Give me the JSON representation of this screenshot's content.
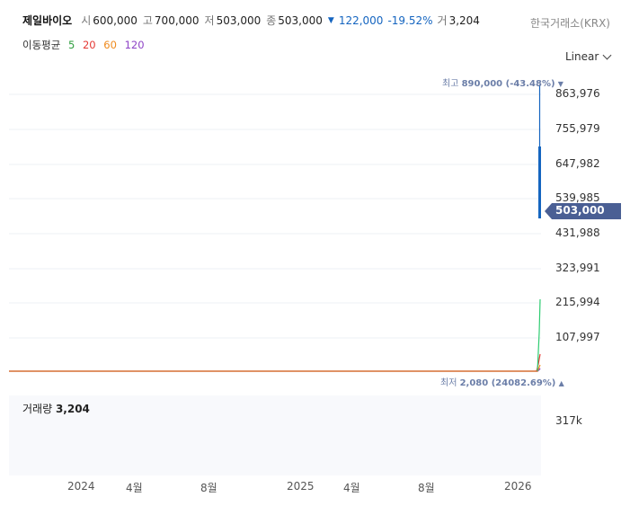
{
  "header": {
    "stock_name": "제일바이오",
    "open_label": "시",
    "open_value": "600,000",
    "high_label": "고",
    "high_value": "700,000",
    "low_label": "저",
    "low_value": "503,000",
    "close_label": "종",
    "close_value": "503,000",
    "change_arrow": "▼",
    "change_value": "122,000",
    "change_pct": "-19.52%",
    "volume_label": "거",
    "volume_value": "3,204",
    "exchange": "한국거래소(KRX)"
  },
  "moving_average": {
    "label": "이동평균",
    "periods": [
      {
        "value": "5",
        "color": "#2e9e3e"
      },
      {
        "value": "20",
        "color": "#e53935"
      },
      {
        "value": "60",
        "color": "#ef8a1c"
      },
      {
        "value": "120",
        "color": "#8e44c6"
      }
    ]
  },
  "scale_selector": {
    "value": "Linear"
  },
  "price_axis": {
    "ticks": [
      "863,976",
      "755,979",
      "647,982",
      "539,985",
      "431,988",
      "323,991",
      "215,994",
      "107,997"
    ]
  },
  "high_marker": {
    "label": "최고",
    "value": "890,000 (-43.48%)",
    "arrow": "▼"
  },
  "low_marker": {
    "label": "최저",
    "value": "2,080 (24082.69%)",
    "arrow": "▲"
  },
  "current_price_tag": "503,000",
  "volume": {
    "label": "거래량",
    "value": "3,204",
    "axis_tick": "317k"
  },
  "time_axis": {
    "labels": [
      "2024",
      "4월",
      "8월",
      "2025",
      "4월",
      "8월",
      "2026"
    ]
  },
  "chart_data": {
    "type": "line",
    "ylim": [
      0,
      890000
    ],
    "scale": "linear",
    "grid": true,
    "latest_candle": {
      "open": 600000,
      "high": 700000,
      "low": 503000,
      "close": 503000,
      "previous_high": 890000
    },
    "series": [
      {
        "name": "5",
        "values": [
          2080,
          2080,
          2080,
          2080,
          215994
        ],
        "color": "#2e9e3e"
      },
      {
        "name": "20",
        "values": [
          2080,
          2080,
          2080,
          2080,
          55000
        ],
        "color": "#e53935"
      },
      {
        "name": "60",
        "values": [
          2080,
          2080,
          2080,
          2080,
          20000
        ],
        "color": "#ef8a1c"
      },
      {
        "name": "120",
        "values": [
          2080,
          2080,
          2080,
          2080,
          10000
        ],
        "color": "#8e44c6"
      }
    ],
    "volume_axis_tick": "317k",
    "x_ticks": [
      "2024",
      "4월",
      "8월",
      "2025",
      "4월",
      "8월",
      "2026"
    ],
    "colors": {
      "down": "#1565c0",
      "tag": "#4a5f94",
      "grid": "#eef1f6"
    }
  }
}
